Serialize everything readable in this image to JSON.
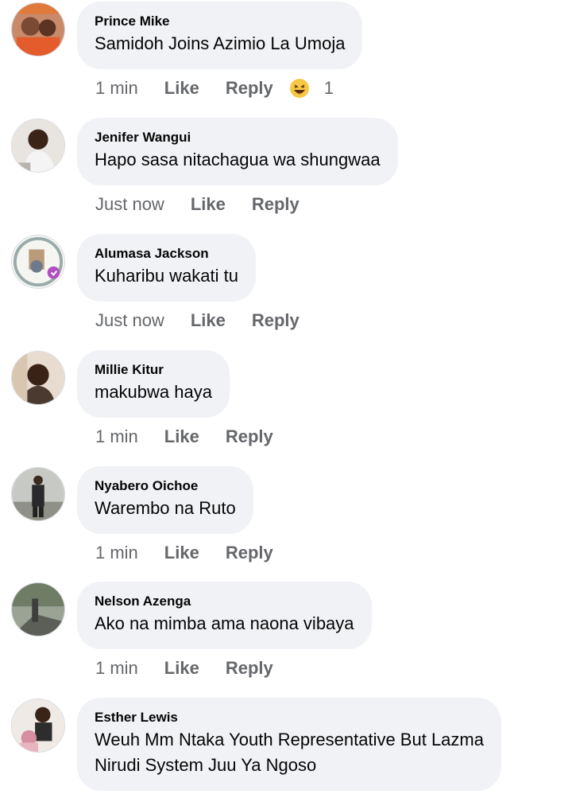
{
  "comments": [
    {
      "author": "Prince Mike",
      "text": "Samidoh Joins Azimio La Umoja",
      "time": "1 min",
      "like_label": "Like",
      "reply_label": "Reply",
      "reaction": {
        "icon": "haha-emoji-icon",
        "count": "1"
      }
    },
    {
      "author": "Jenifer Wangui",
      "text": "Hapo sasa nitachagua wa shungwaa",
      "time": "Just now",
      "like_label": "Like",
      "reply_label": "Reply"
    },
    {
      "author": "Alumasa Jackson",
      "text": "Kuharibu wakati tu",
      "time": "Just now",
      "like_label": "Like",
      "reply_label": "Reply"
    },
    {
      "author": "Millie Kitur",
      "text": "makubwa haya",
      "time": "1 min",
      "like_label": "Like",
      "reply_label": "Reply"
    },
    {
      "author": "Nyabero Oichoe",
      "text": "Warembo na  Ruto",
      "time": "1 min",
      "like_label": "Like",
      "reply_label": "Reply"
    },
    {
      "author": "Nelson Azenga",
      "text": "Ako na mimba ama naona vibaya",
      "time": "1 min",
      "like_label": "Like",
      "reply_label": "Reply"
    },
    {
      "author": "Esther Lewis",
      "text_lines": [
        "Weuh Mm Ntaka Youth Representative But Lazma",
        "Nirudi System Juu Ya Ngoso"
      ]
    }
  ],
  "colors": {
    "bubble_bg": "#f0f2f5",
    "meta_text": "#65676b",
    "primary_text": "#050505"
  }
}
